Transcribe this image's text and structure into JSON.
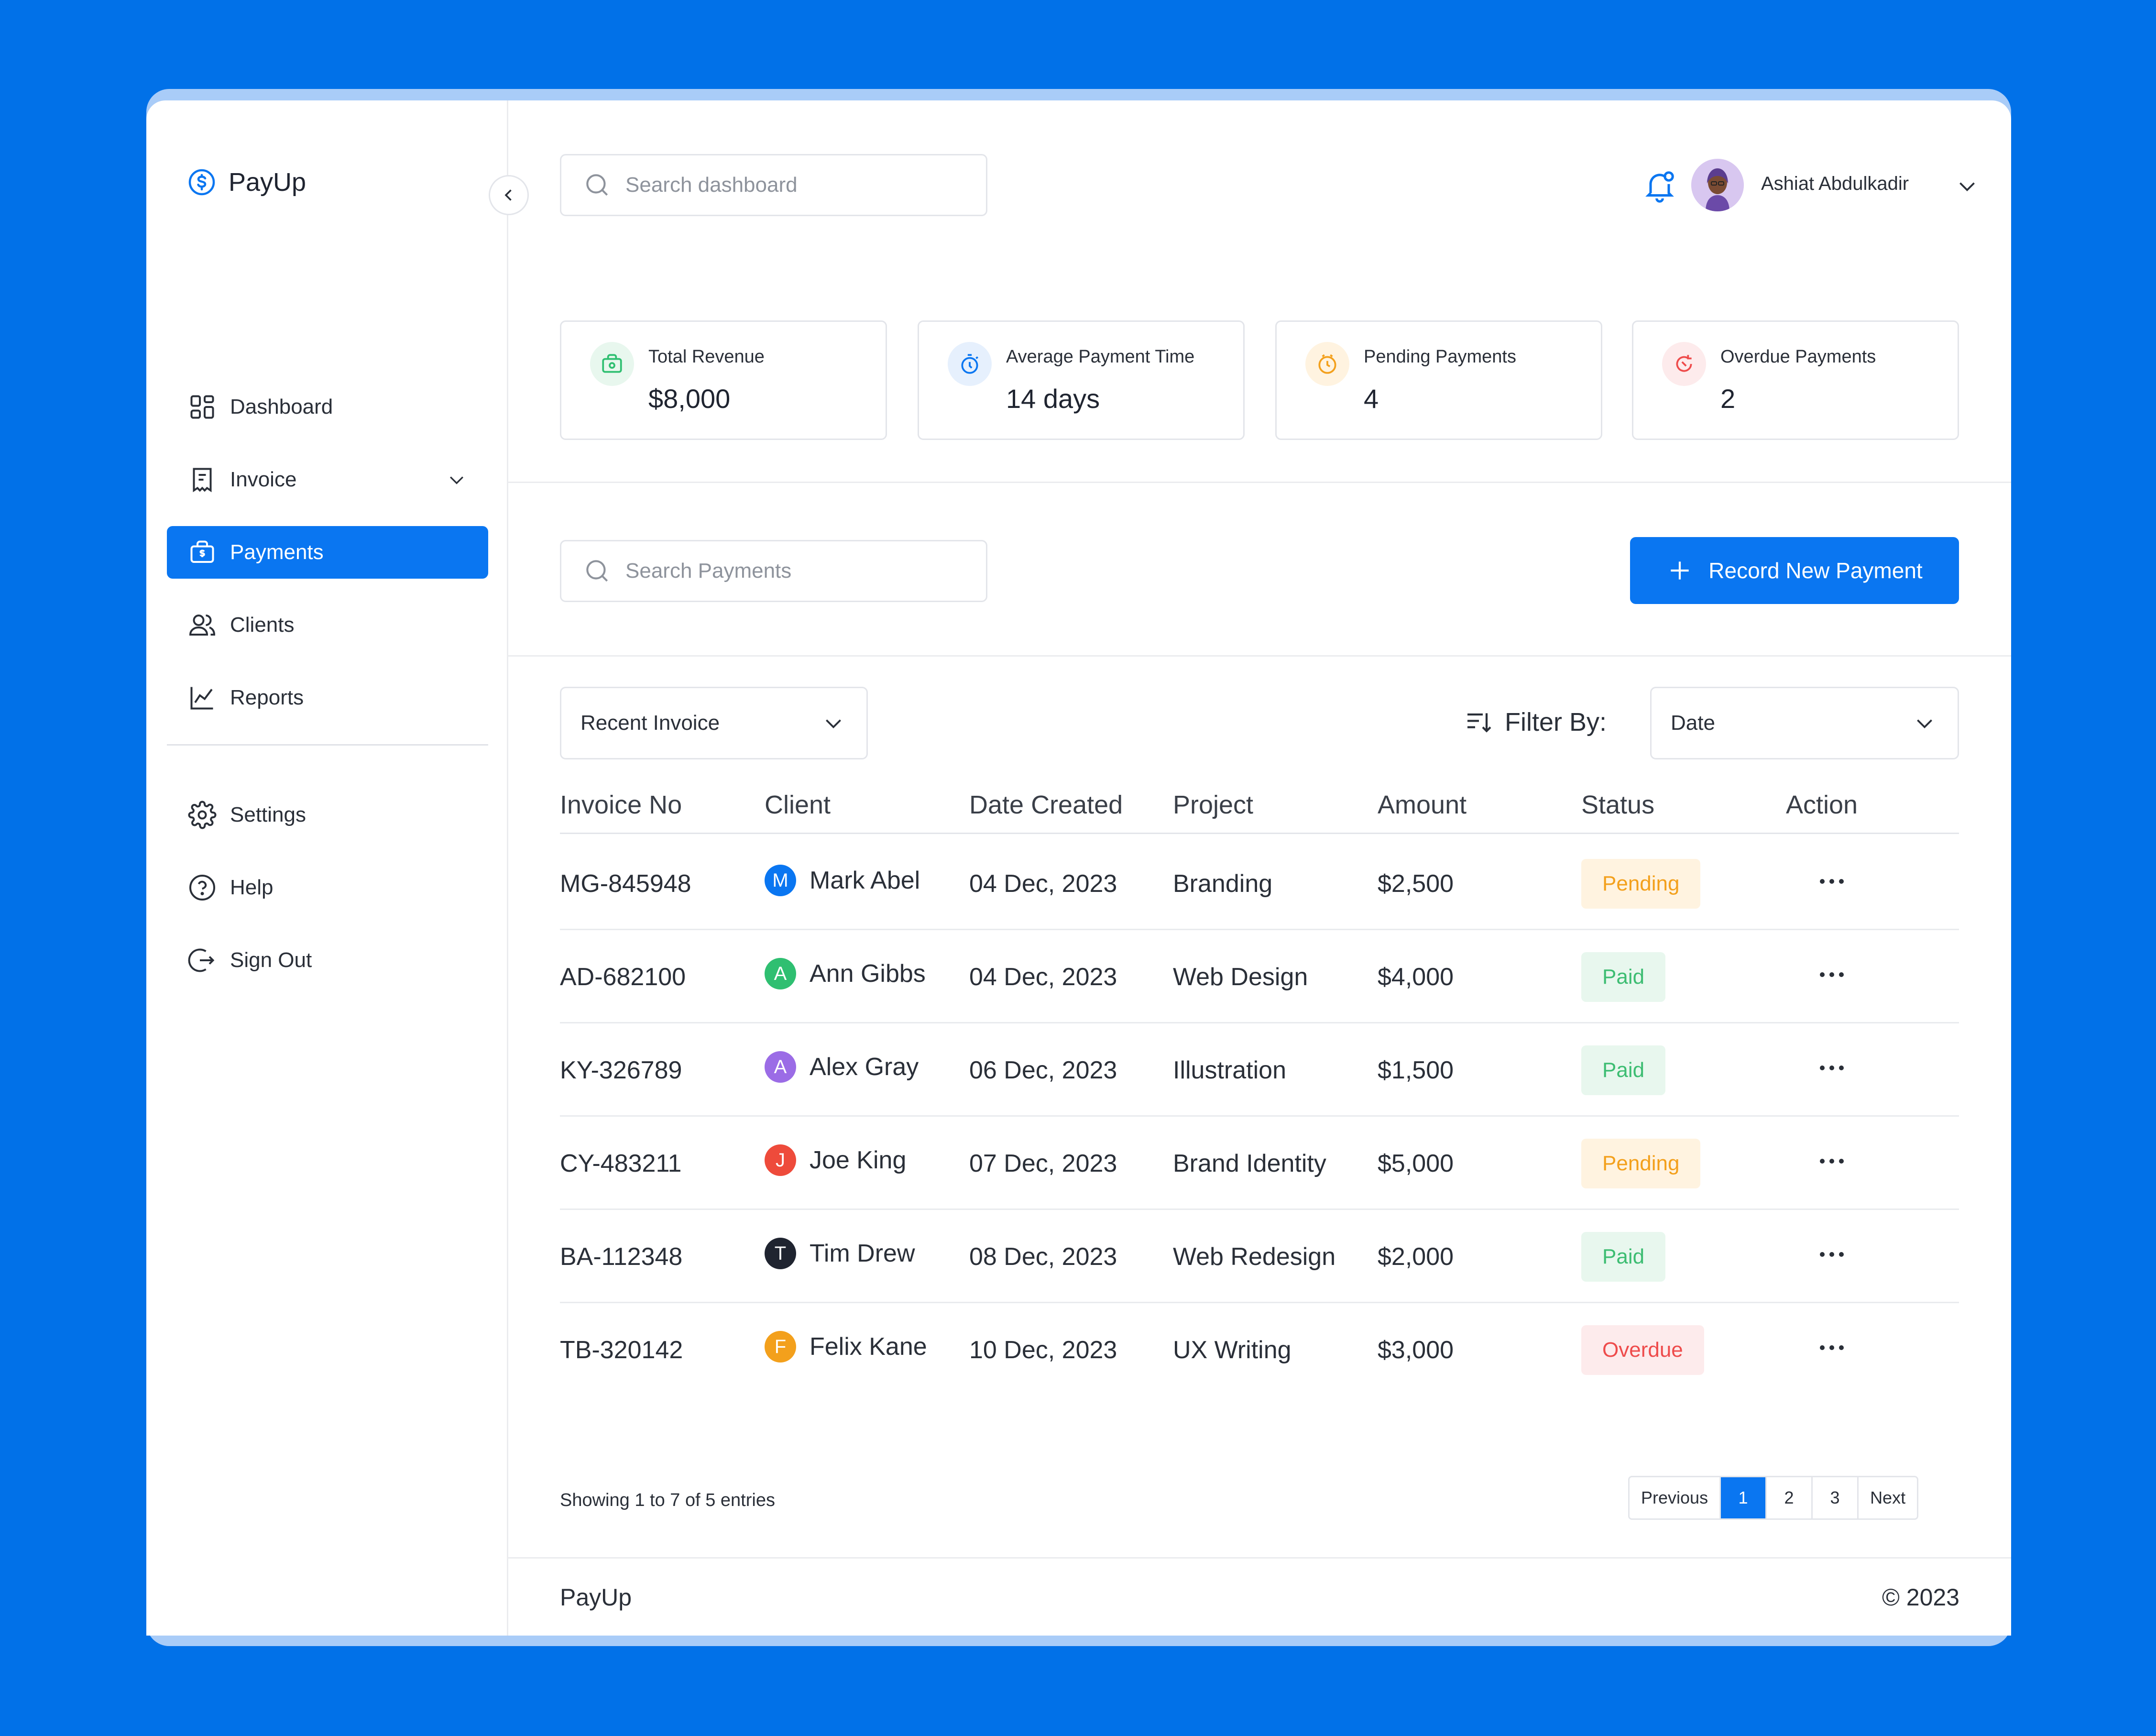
{
  "app": {
    "name": "PayUp"
  },
  "sidebar": {
    "items": [
      {
        "label": "Dashboard",
        "icon": "dashboard-icon"
      },
      {
        "label": "Invoice",
        "icon": "invoice-icon"
      },
      {
        "label": "Payments",
        "icon": "payments-icon",
        "active": true
      },
      {
        "label": "Clients",
        "icon": "clients-icon"
      },
      {
        "label": "Reports",
        "icon": "reports-icon"
      }
    ],
    "bottom_items": [
      {
        "label": "Settings",
        "icon": "gear-icon"
      },
      {
        "label": "Help",
        "icon": "help-icon"
      },
      {
        "label": "Sign Out",
        "icon": "sign-out-icon"
      }
    ]
  },
  "header": {
    "search_placeholder": "Search dashboard",
    "user_name": "Ashiat Abdulkadir"
  },
  "stats": [
    {
      "label": "Total Revenue",
      "value": "$8,000",
      "icon": "money-icon",
      "color": "#2fbf71",
      "bg": "#e8f7ee"
    },
    {
      "label": "Average Payment Time",
      "value": "14 days",
      "icon": "timer-icon",
      "color": "#0a76f1",
      "bg": "#e6f0fd"
    },
    {
      "label": "Pending Payments",
      "value": "4",
      "icon": "clock-icon",
      "color": "#f3a01c",
      "bg": "#fff3e0"
    },
    {
      "label": "Overdue Payments",
      "value": "2",
      "icon": "overdue-icon",
      "color": "#ee4b4b",
      "bg": "#fdebec"
    }
  ],
  "payments": {
    "search_placeholder": "Search Payments",
    "record_button": "Record New Payment"
  },
  "table": {
    "type_select": "Recent Invoice",
    "filter_label": "Filter By:",
    "filter_select": "Date",
    "headers": [
      "Invoice No",
      "Client",
      "Date Created",
      "Project",
      "Amount",
      "Status",
      "Action"
    ],
    "rows": [
      {
        "invoice": "MG-845948",
        "initial": "M",
        "client": "Mark Abel",
        "date": "04 Dec, 2023",
        "project": "Branding",
        "amount": "$2,500",
        "status": "Pending",
        "status_kind": "pending",
        "color": "#0a76f1"
      },
      {
        "invoice": "AD-682100",
        "initial": "A",
        "client": "Ann Gibbs",
        "date": "04 Dec, 2023",
        "project": "Web Design",
        "amount": "$4,000",
        "status": "Paid",
        "status_kind": "paid",
        "color": "#2fbf71"
      },
      {
        "invoice": "KY-326789",
        "initial": "A",
        "client": "Alex Gray",
        "date": "06 Dec, 2023",
        "project": "Illustration",
        "amount": "$1,500",
        "status": "Paid",
        "status_kind": "paid",
        "color": "#9b6ce6"
      },
      {
        "invoice": "CY-483211",
        "initial": "J",
        "client": "Joe King",
        "date": "07 Dec, 2023",
        "project": "Brand Identity",
        "amount": "$5,000",
        "status": "Pending",
        "status_kind": "pending",
        "color": "#ee4b3b"
      },
      {
        "invoice": "BA-112348",
        "initial": "T",
        "client": "Tim Drew",
        "date": "08 Dec, 2023",
        "project": "Web Redesign",
        "amount": "$2,000",
        "status": "Paid",
        "status_kind": "paid",
        "color": "#1f2430"
      },
      {
        "invoice": "TB-320142",
        "initial": "F",
        "client": "Felix Kane",
        "date": "10 Dec, 2023",
        "project": "UX Writing",
        "amount": "$3,000",
        "status": "Overdue",
        "status_kind": "overdue",
        "color": "#f3a01c"
      }
    ],
    "entries_info": "Showing 1 to 7 of 5 entries",
    "pagination": {
      "previous": "Previous",
      "pages": [
        "1",
        "2",
        "3"
      ],
      "current": "1",
      "next": "Next"
    }
  },
  "footer": {
    "brand": "PayUp",
    "copyright": "© 2023"
  }
}
